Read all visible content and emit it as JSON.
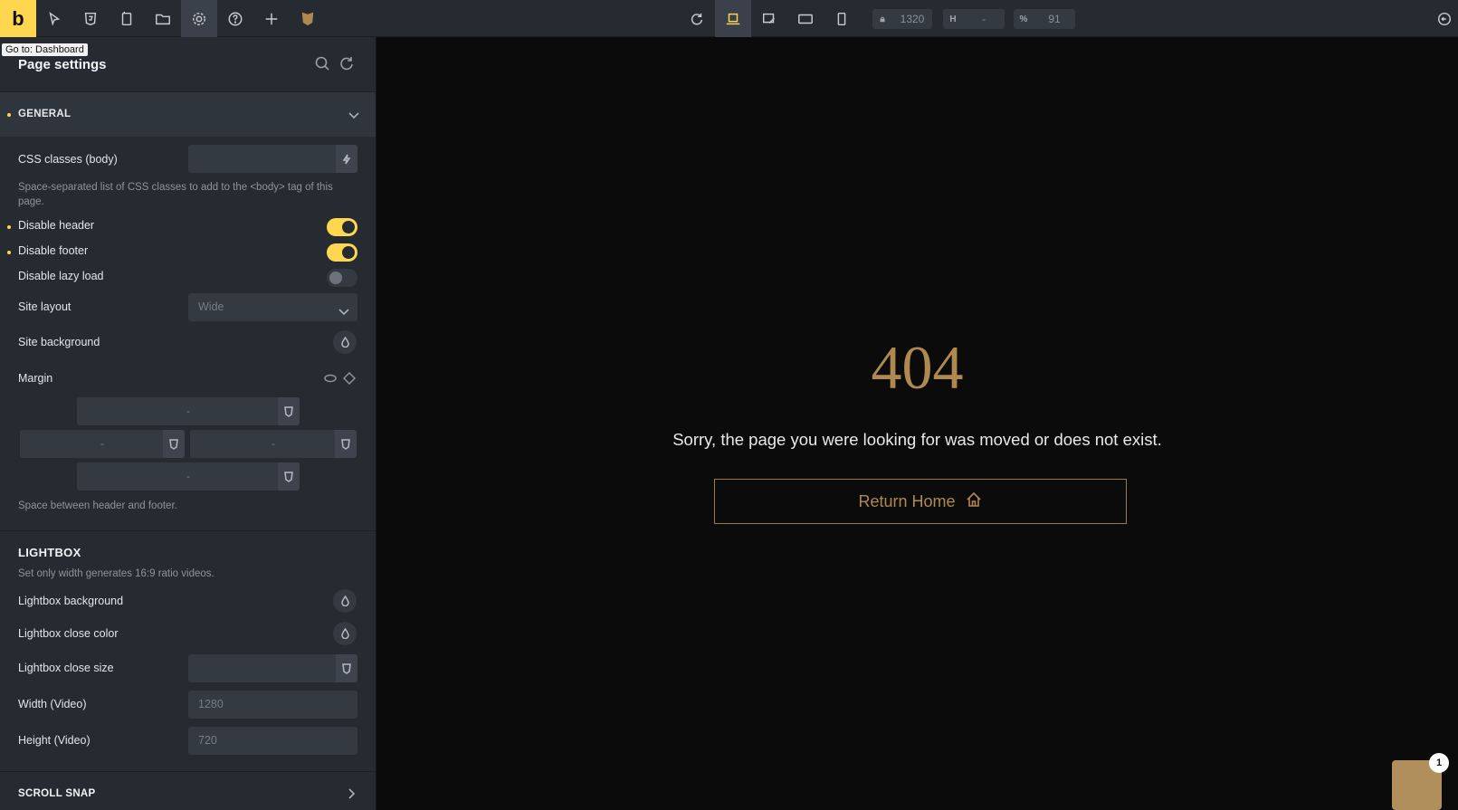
{
  "topbar": {
    "logo": "b",
    "width_value": "1320",
    "height_prefix": "H",
    "height_value": "-",
    "zoom_prefix": "%",
    "zoom_value": "91",
    "tooltip": "Go to: Dashboard"
  },
  "panel": {
    "title": "Page settings",
    "general_label": "GENERAL",
    "css_classes_label": "CSS classes (body)",
    "css_classes_desc": "Space-separated list of CSS classes to add to the <body> tag of this page.",
    "disable_header_label": "Disable header",
    "disable_header_on": true,
    "disable_footer_label": "Disable footer",
    "disable_footer_on": true,
    "disable_lazy_label": "Disable lazy load",
    "disable_lazy_on": false,
    "site_layout_label": "Site layout",
    "site_layout_value": "Wide",
    "site_background_label": "Site background",
    "margin_label": "Margin",
    "margin_top": "-",
    "margin_left": "-",
    "margin_right": "-",
    "margin_bottom": "-",
    "margin_desc": "Space between header and footer.",
    "lightbox_title": "LIGHTBOX",
    "lightbox_desc": "Set only width generates 16:9 ratio videos.",
    "lightbox_bg_label": "Lightbox background",
    "lightbox_close_color_label": "Lightbox close color",
    "lightbox_close_size_label": "Lightbox close size",
    "width_video_label": "Width (Video)",
    "width_video_placeholder": "1280",
    "height_video_label": "Height (Video)",
    "height_video_placeholder": "720",
    "scroll_snap_label": "SCROLL SNAP"
  },
  "canvas": {
    "error_code": "404",
    "message": "Sorry, the page you were looking for was moved or does not exist.",
    "button_label": "Return Home",
    "chat_badge": "1"
  },
  "colors": {
    "accent": "#ffd64f",
    "gold": "#b0894f",
    "panel": "#262b31"
  }
}
